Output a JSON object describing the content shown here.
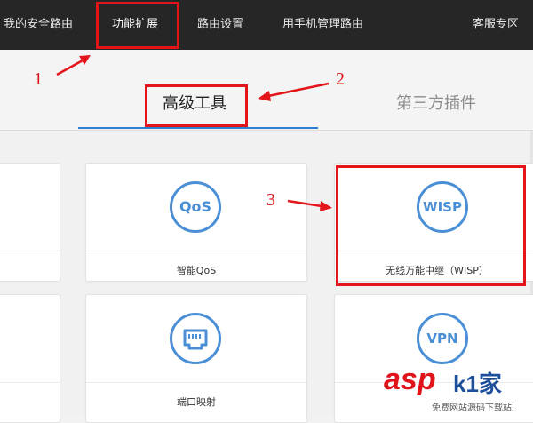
{
  "header": {
    "nav": [
      {
        "label": "我的安全路由"
      },
      {
        "label": "功能扩展"
      },
      {
        "label": "路由设置"
      },
      {
        "label": "用手机管理路由"
      }
    ],
    "service": "客服专区"
  },
  "tabs": [
    {
      "label": "高级工具"
    },
    {
      "label": "第三方插件"
    }
  ],
  "cards": [
    {
      "label": "智能QoS",
      "icon": "qos-icon",
      "icon_text": "QoS"
    },
    {
      "label": "无线万能中继（WISP）",
      "icon": "wisp-icon",
      "icon_text": "WISP"
    },
    {
      "label": "端口映射",
      "icon": "port-mapping-icon"
    },
    {
      "label": "",
      "icon": "vpn-icon",
      "icon_text": "VPN"
    }
  ],
  "annotations": [
    "1",
    "2",
    "3"
  ],
  "watermark": {
    "logo": "asp",
    "logo_extra": "k1家",
    "sub": "免费网站源码下载站!"
  },
  "colors": {
    "accent": "#4a8fd6",
    "highlight": "#e3151a",
    "topbar": "#262626",
    "tab_underline": "#2b7fd0"
  }
}
